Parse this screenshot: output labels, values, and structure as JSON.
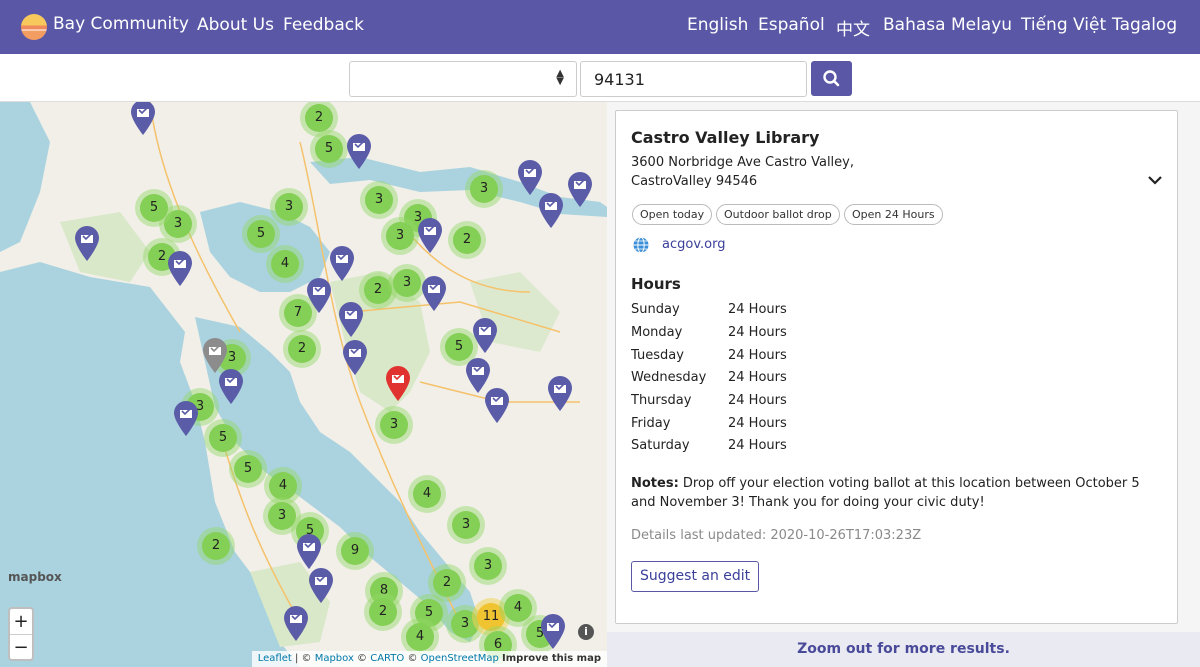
{
  "header": {
    "brand": "Bay Community",
    "nav": [
      "About Us",
      "Feedback"
    ],
    "languages": [
      "English",
      "Español",
      "中文",
      "Bahasa Melayu",
      "Tiếng Việt",
      "Tagalog"
    ]
  },
  "search": {
    "select_value": "",
    "zip_value": "94131",
    "button_icon": "search-icon"
  },
  "map": {
    "clusters": [
      "2",
      "5",
      "3",
      "3",
      "3",
      "3",
      "3",
      "5",
      "3",
      "2",
      "5",
      "2",
      "4",
      "2",
      "3",
      "2",
      "7",
      "2",
      "3",
      "5",
      "3",
      "3",
      "5",
      "5",
      "4",
      "3",
      "4",
      "3",
      "5",
      "9",
      "2",
      "3",
      "8",
      "2",
      "2",
      "5",
      "3",
      "11",
      "4",
      "4",
      "6",
      "5"
    ],
    "zoom_in": "+",
    "zoom_out": "−",
    "mapbox_logo": "mapbox",
    "attribution": {
      "leaflet": "Leaflet",
      "sep1": " | © ",
      "mapbox": "Mapbox",
      "sep2": " © ",
      "carto": "CARTO",
      "sep3": " © ",
      "osm": "OpenStreetMap",
      "improve": "Improve this map"
    },
    "info_icon": "i"
  },
  "location": {
    "name": "Castro Valley Library",
    "address_line1": "3600 Norbridge Ave Castro Valley,",
    "address_line2": "CastroValley 94546",
    "tags": [
      "Open today",
      "Outdoor ballot drop",
      "Open 24 Hours"
    ],
    "website": "acgov.org",
    "hours_title": "Hours",
    "hours": [
      {
        "day": "Sunday",
        "time": "24 Hours"
      },
      {
        "day": "Monday",
        "time": "24 Hours"
      },
      {
        "day": "Tuesday",
        "time": "24 Hours"
      },
      {
        "day": "Wednesday",
        "time": "24 Hours"
      },
      {
        "day": "Thursday",
        "time": "24 Hours"
      },
      {
        "day": "Friday",
        "time": "24 Hours"
      },
      {
        "day": "Saturday",
        "time": "24 Hours"
      }
    ],
    "notes_label": "Notes:",
    "notes_text": " Drop off your election voting ballot at this location between October 5 and November 3! Thank you for doing your civic duty!",
    "updated": "Details last updated: 2020-10-26T17:03:23Z",
    "suggest": "Suggest an edit"
  },
  "footer": {
    "zoom_message": "Zoom out for more results."
  },
  "colors": {
    "brand": "#5a58a6",
    "cluster_green": "#84cf55",
    "cluster_yellow": "#f0c330",
    "pin_blue": "#5a5ca8",
    "pin_selected": "#e0322e"
  }
}
